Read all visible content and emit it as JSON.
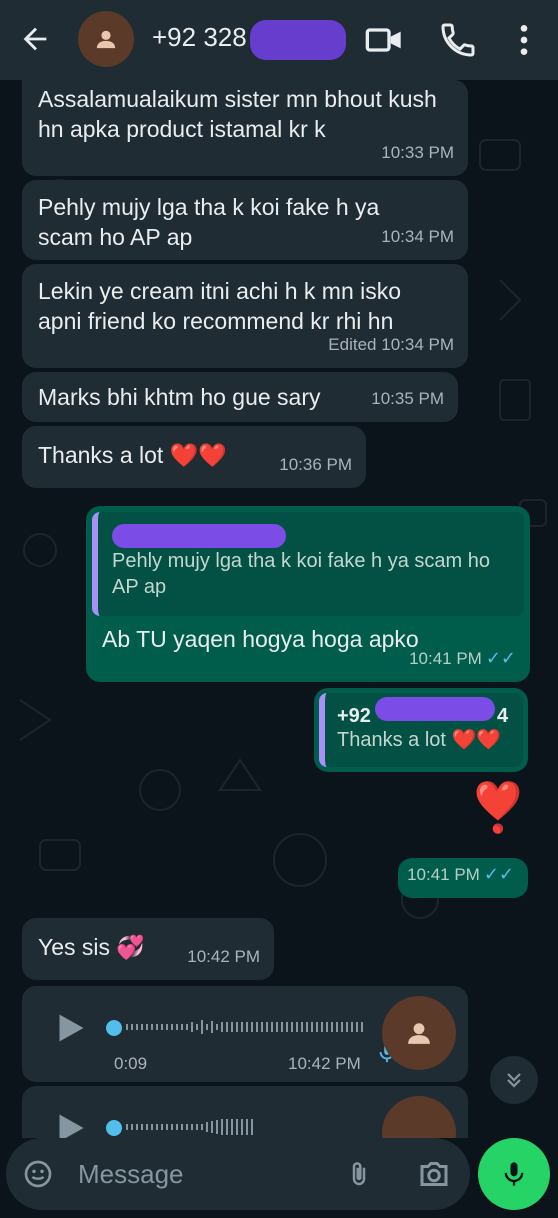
{
  "header": {
    "title": "+92 328",
    "icons": [
      "back-arrow-icon",
      "avatar-icon",
      "video-call-icon",
      "phone-icon",
      "more-vert-icon"
    ]
  },
  "messages": [
    {
      "text": "Assalamualaikum sister mn bhout kush hn apka product istamal kr k",
      "time": "10:33 PM"
    },
    {
      "text": "Pehly mujy lga tha k koi fake h ya scam ho AP ap",
      "time": "10:34 PM"
    },
    {
      "text": "Lekin ye cream itni achi h k mn isko apni friend ko recommend kr rhi hn",
      "edited": "Edited",
      "time": "10:34 PM"
    },
    {
      "text": "Marks bhi khtm ho gue sary",
      "time": "10:35 PM"
    },
    {
      "text": "Thanks a lot ❤️❤️",
      "time": "10:36 PM"
    }
  ],
  "reply1": {
    "quote_text": "Pehly mujy lga tha k koi fake h ya scam ho AP ap",
    "text": "Ab TU yaqen hogya hoga apko",
    "time": "10:41 PM",
    "ticks": "✓✓"
  },
  "reply2": {
    "quote_name": "+92",
    "quote_suffix": "4",
    "quote_text": "Thanks a lot ❤️❤️",
    "emoji": "❣️",
    "time": "10:41 PM",
    "ticks": "✓✓"
  },
  "incoming_yes": {
    "text": "Yes sis 💞",
    "time": "10:42 PM"
  },
  "voice_note": {
    "duration": "0:09",
    "time": "10:42 PM"
  },
  "composer": {
    "placeholder": "Message"
  },
  "colors": {
    "background": "#0b141a",
    "header": "#1f2c33",
    "incoming_bubble": "#202c33",
    "outgoing_bubble": "#005c4b",
    "accent_green": "#25d366",
    "read_ticks": "#53bdeb"
  }
}
